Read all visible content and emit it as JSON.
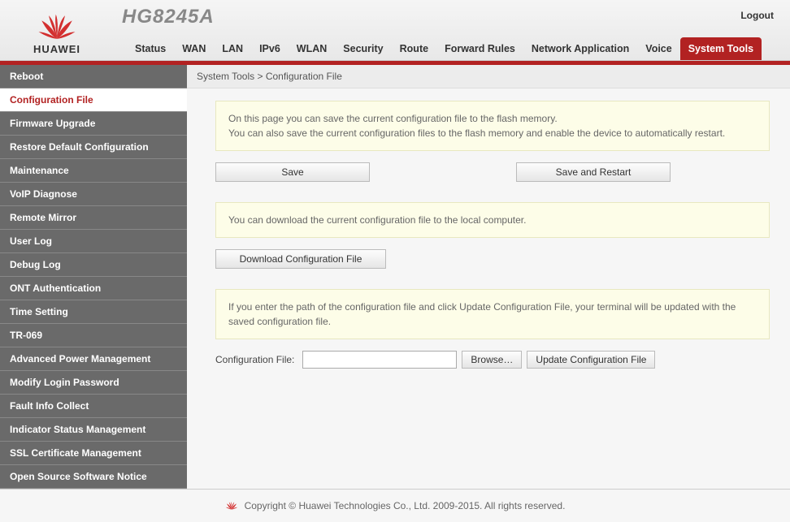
{
  "brand": {
    "name": "HUAWEI",
    "model": "HG8245A"
  },
  "header": {
    "logout": "Logout"
  },
  "nav": {
    "items": [
      {
        "label": "Status"
      },
      {
        "label": "WAN"
      },
      {
        "label": "LAN"
      },
      {
        "label": "IPv6"
      },
      {
        "label": "WLAN"
      },
      {
        "label": "Security"
      },
      {
        "label": "Route"
      },
      {
        "label": "Forward Rules"
      },
      {
        "label": "Network Application"
      },
      {
        "label": "Voice"
      },
      {
        "label": "System Tools",
        "active": true
      }
    ]
  },
  "sidebar": {
    "items": [
      {
        "label": "Reboot"
      },
      {
        "label": "Configuration File",
        "active": true
      },
      {
        "label": "Firmware Upgrade"
      },
      {
        "label": "Restore Default Configuration"
      },
      {
        "label": "Maintenance"
      },
      {
        "label": "VoIP Diagnose"
      },
      {
        "label": "Remote Mirror"
      },
      {
        "label": "User Log"
      },
      {
        "label": "Debug Log"
      },
      {
        "label": "ONT Authentication"
      },
      {
        "label": "Time Setting"
      },
      {
        "label": "TR-069"
      },
      {
        "label": "Advanced Power Management"
      },
      {
        "label": "Modify Login Password"
      },
      {
        "label": "Fault Info Collect"
      },
      {
        "label": "Indicator Status Management"
      },
      {
        "label": "SSL Certificate Management"
      },
      {
        "label": "Open Source Software Notice"
      }
    ]
  },
  "breadcrumb": "System Tools > Configuration File",
  "page": {
    "info1_line1": "On this page you can save the current configuration file to the flash memory.",
    "info1_line2": "You can also save the current configuration files to the flash memory and enable the device to automatically restart.",
    "save_btn": "Save",
    "save_restart_btn": "Save and Restart",
    "info2": "You can download the current configuration file to the local computer.",
    "download_btn": "Download Configuration File",
    "info3": "If you enter the path of the configuration file and click Update Configuration File, your terminal will be updated with the saved configuration file.",
    "file_label": "Configuration File:",
    "browse_btn": "Browse…",
    "update_btn": "Update Configuration File"
  },
  "footer": "Copyright © Huawei Technologies Co., Ltd. 2009-2015. All rights reserved."
}
